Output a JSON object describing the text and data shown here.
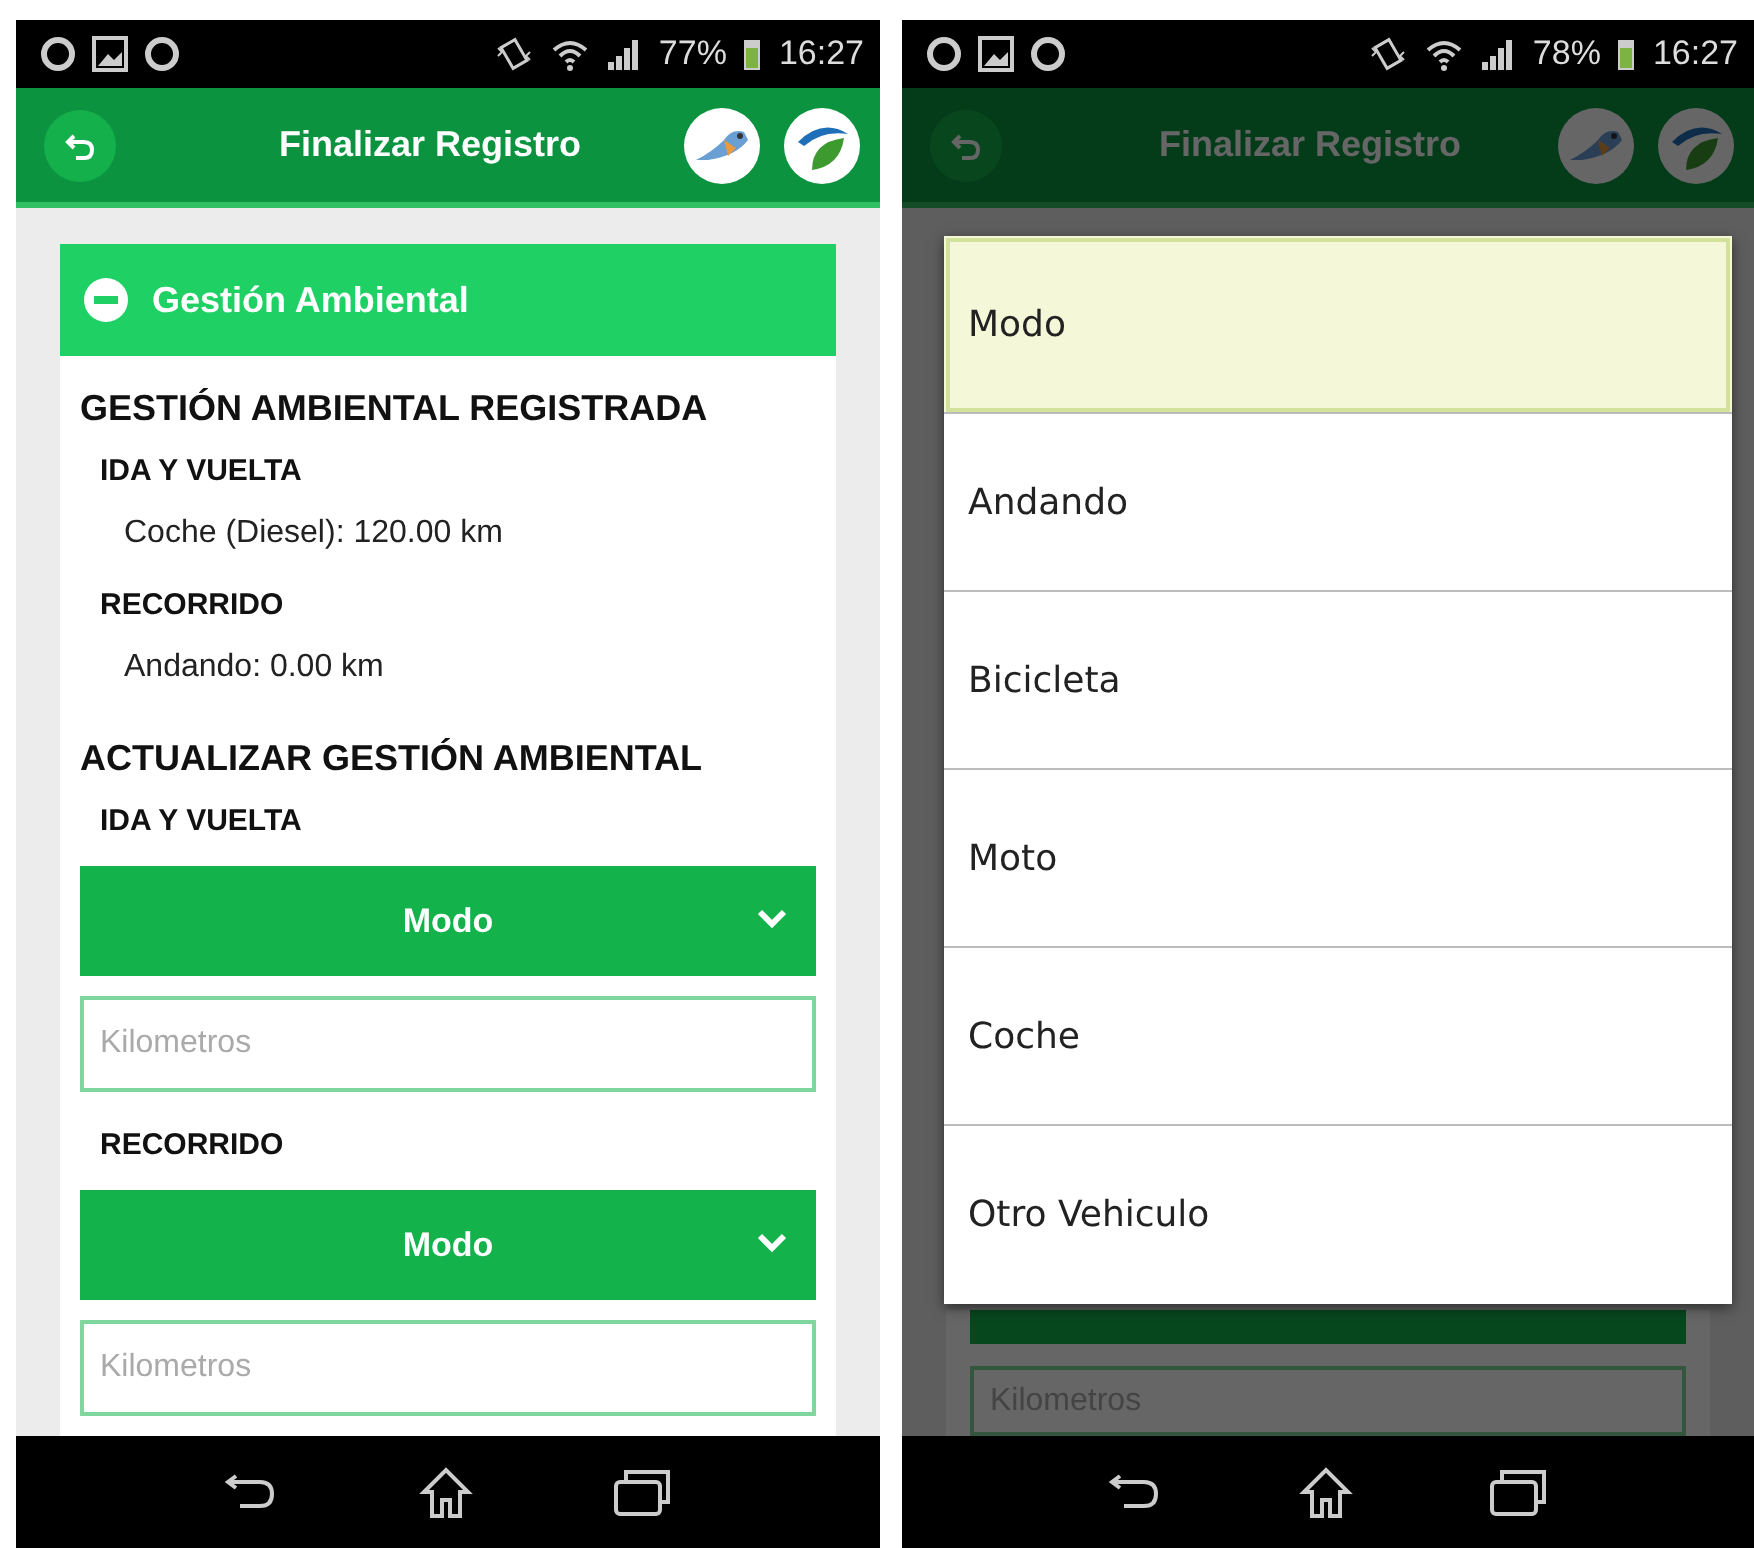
{
  "left_phone": {
    "status_bar": {
      "battery": "77%",
      "time": "16:27"
    },
    "app_bar": {
      "title": "Finalizar Registro"
    },
    "section": {
      "title": "Gestión Ambiental",
      "expanded": true,
      "registered_title": "GESTIÓN AMBIENTAL REGISTRADA",
      "registered_groups": [
        {
          "heading": "IDA Y VUELTA",
          "entries": [
            "Coche (Diesel): 120.00 km"
          ]
        },
        {
          "heading": "RECORRIDO",
          "entries": [
            "Andando: 0.00 km"
          ]
        }
      ],
      "update_title": "ACTUALIZAR GESTIÓN AMBIENTAL",
      "update_groups": [
        {
          "heading": "IDA Y VUELTA",
          "select_label": "Modo",
          "km_placeholder": "Kilometros"
        },
        {
          "heading": "RECORRIDO",
          "select_label": "Modo",
          "km_placeholder": "Kilometros"
        }
      ]
    }
  },
  "right_phone": {
    "status_bar": {
      "battery": "78%",
      "time": "16:27"
    },
    "app_bar": {
      "title": "Finalizar Registro"
    },
    "background": {
      "km_placeholder": "Kilometros"
    },
    "dialog": {
      "options": [
        {
          "label": "Modo",
          "selected": true
        },
        {
          "label": "Andando",
          "selected": false
        },
        {
          "label": "Bicicleta",
          "selected": false
        },
        {
          "label": "Moto",
          "selected": false
        },
        {
          "label": "Coche",
          "selected": false
        },
        {
          "label": "Otro Vehiculo",
          "selected": false
        }
      ]
    }
  }
}
